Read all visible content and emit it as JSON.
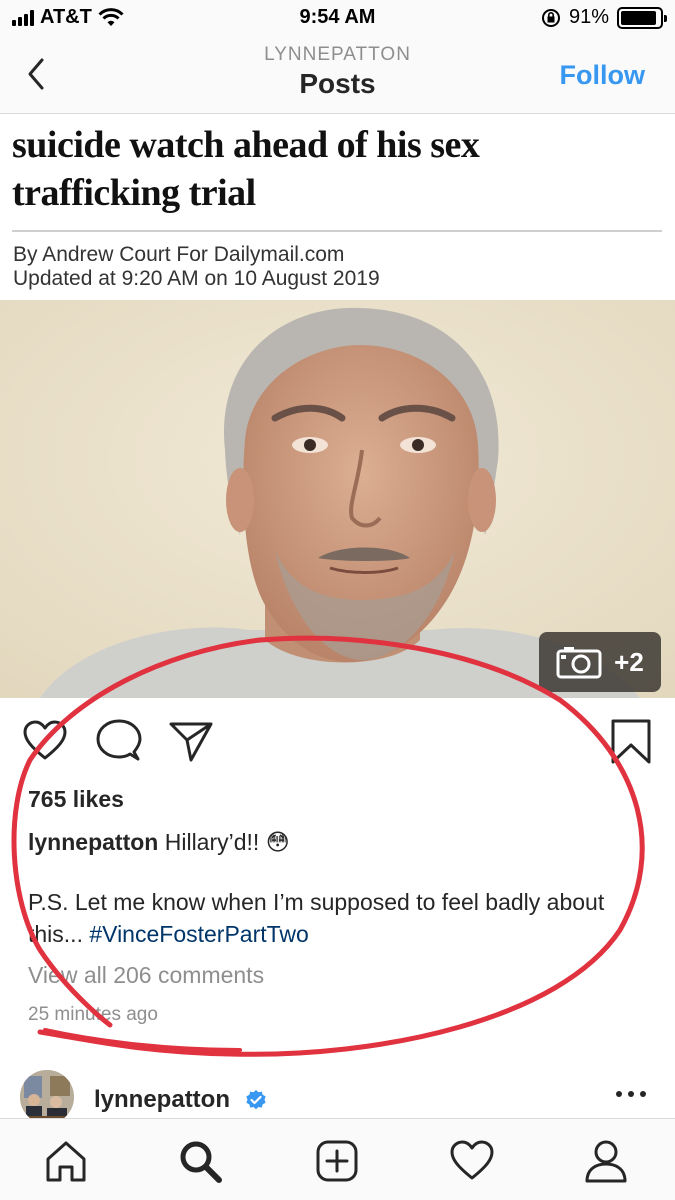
{
  "status_bar": {
    "carrier": "AT&T",
    "time": "9:54 AM",
    "battery": "91%",
    "battery_level": 0.91,
    "icons": [
      "signal-icon",
      "wifi-icon",
      "orientation-lock-icon",
      "battery-icon"
    ]
  },
  "nav": {
    "subtitle": "LYNNEPATTON",
    "title": "Posts",
    "follow_label": "Follow",
    "back_icon": "chevron-left-icon",
    "accent_color": "#3897f0"
  },
  "article": {
    "headline_line1": "suicide watch ahead of his sex",
    "headline_line2": "trafficking trial",
    "byline": "By Andrew Court For Dailymail.com",
    "updated": "Updated at 9:20 AM on 10 August 2019"
  },
  "photo": {
    "badge_icon": "camera-icon",
    "badge_count": "+2"
  },
  "post": {
    "likes": "765 likes",
    "username": "lynnepatton",
    "caption_text": "Hillary’d!! 😳",
    "ps_text": "P.S.  Let me know when I’m supposed to feel badly about this... ",
    "hashtag": "#VinceFosterPartTwo",
    "view_comments": "View all 206 comments",
    "timestamp": "25 minutes ago",
    "action_icons": [
      "heart-icon",
      "comment-icon",
      "share-icon",
      "bookmark-icon"
    ]
  },
  "next_post": {
    "username": "lynnepatton",
    "verified_color": "#3897f0"
  },
  "tab_bar": {
    "icons": [
      "home-icon",
      "search-icon",
      "add-icon",
      "activity-heart-icon",
      "profile-icon"
    ]
  },
  "annotation_color": "#e0323f"
}
